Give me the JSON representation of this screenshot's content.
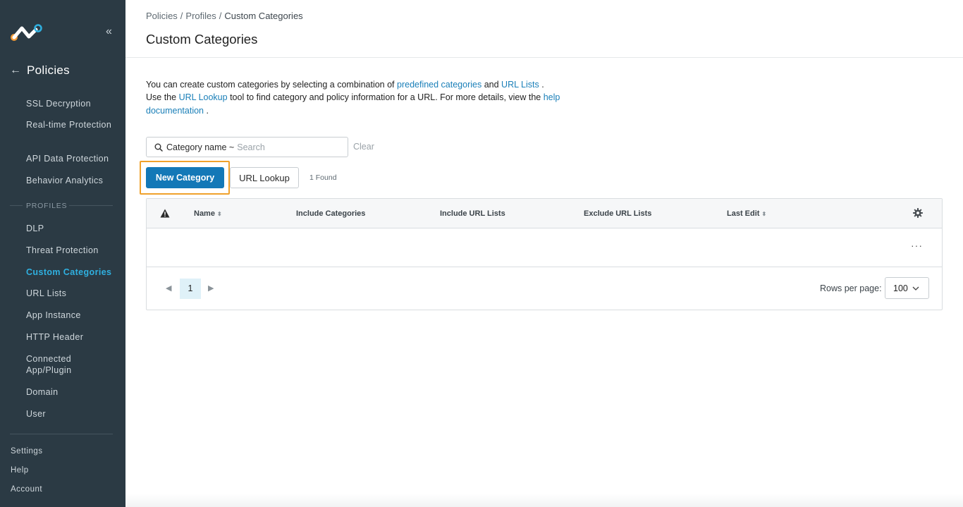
{
  "sidebar": {
    "collapse_glyph": "«",
    "back_arrow": "←",
    "back_title": "Policies",
    "items": [
      {
        "label": "SSL Decryption"
      },
      {
        "label": "Real-time Protection"
      },
      {
        "label": "API Data Protection"
      },
      {
        "label": "Behavior Analytics"
      }
    ],
    "profiles_label": "PROFILES",
    "profile_items": [
      {
        "label": "DLP"
      },
      {
        "label": "Threat Protection"
      },
      {
        "label": "Custom Categories",
        "active": true
      },
      {
        "label": "URL Lists"
      },
      {
        "label": "App Instance"
      },
      {
        "label": "HTTP Header"
      },
      {
        "label": "Connected App/Plugin"
      },
      {
        "label": "Domain"
      },
      {
        "label": "User"
      }
    ],
    "bottom_items": [
      {
        "label": "Settings"
      },
      {
        "label": "Help"
      },
      {
        "label": "Account"
      }
    ],
    "accent_color": "#2fb0e0",
    "background_color": "#2b3a44"
  },
  "header": {
    "breadcrumb": [
      "Policies",
      "/",
      "Profiles",
      "/",
      "Custom Categories"
    ],
    "title": "Custom Categories"
  },
  "intro": {
    "t1": "You can create custom categories by selecting a combination of ",
    "link_predefined": "predefined categories",
    "t2": " and ",
    "link_url_lists": "URL Lists",
    "t3": " . Use the ",
    "link_url_lookup": "URL Lookup",
    "t4": " tool to find category and policy information for a URL. For more details, view the ",
    "link_help": "help documentation",
    "t5": " ."
  },
  "search": {
    "field_label": "Category name ~",
    "placeholder": "Search",
    "value": "",
    "clear_label": "Clear"
  },
  "actions": {
    "new_category": "New Category",
    "url_lookup": "URL Lookup",
    "found": "1 Found",
    "highlight_color": "#f0a12b",
    "primary_color": "#1378b7"
  },
  "table": {
    "columns": [
      {
        "label": "Name",
        "sortable": true
      },
      {
        "label": "Include Categories"
      },
      {
        "label": "Include URL Lists"
      },
      {
        "label": "Exclude URL Lists"
      },
      {
        "label": "Last Edit",
        "sortable": true
      }
    ],
    "sort_caret": "⬍",
    "row_menu": "···",
    "header_icons": [
      "warning-icon",
      "gear-icon"
    ]
  },
  "pagination": {
    "prev": "◀",
    "current_page": "1",
    "next": "▶",
    "rows_per_page_label": "Rows per page:",
    "rows_per_page_value": "100"
  }
}
